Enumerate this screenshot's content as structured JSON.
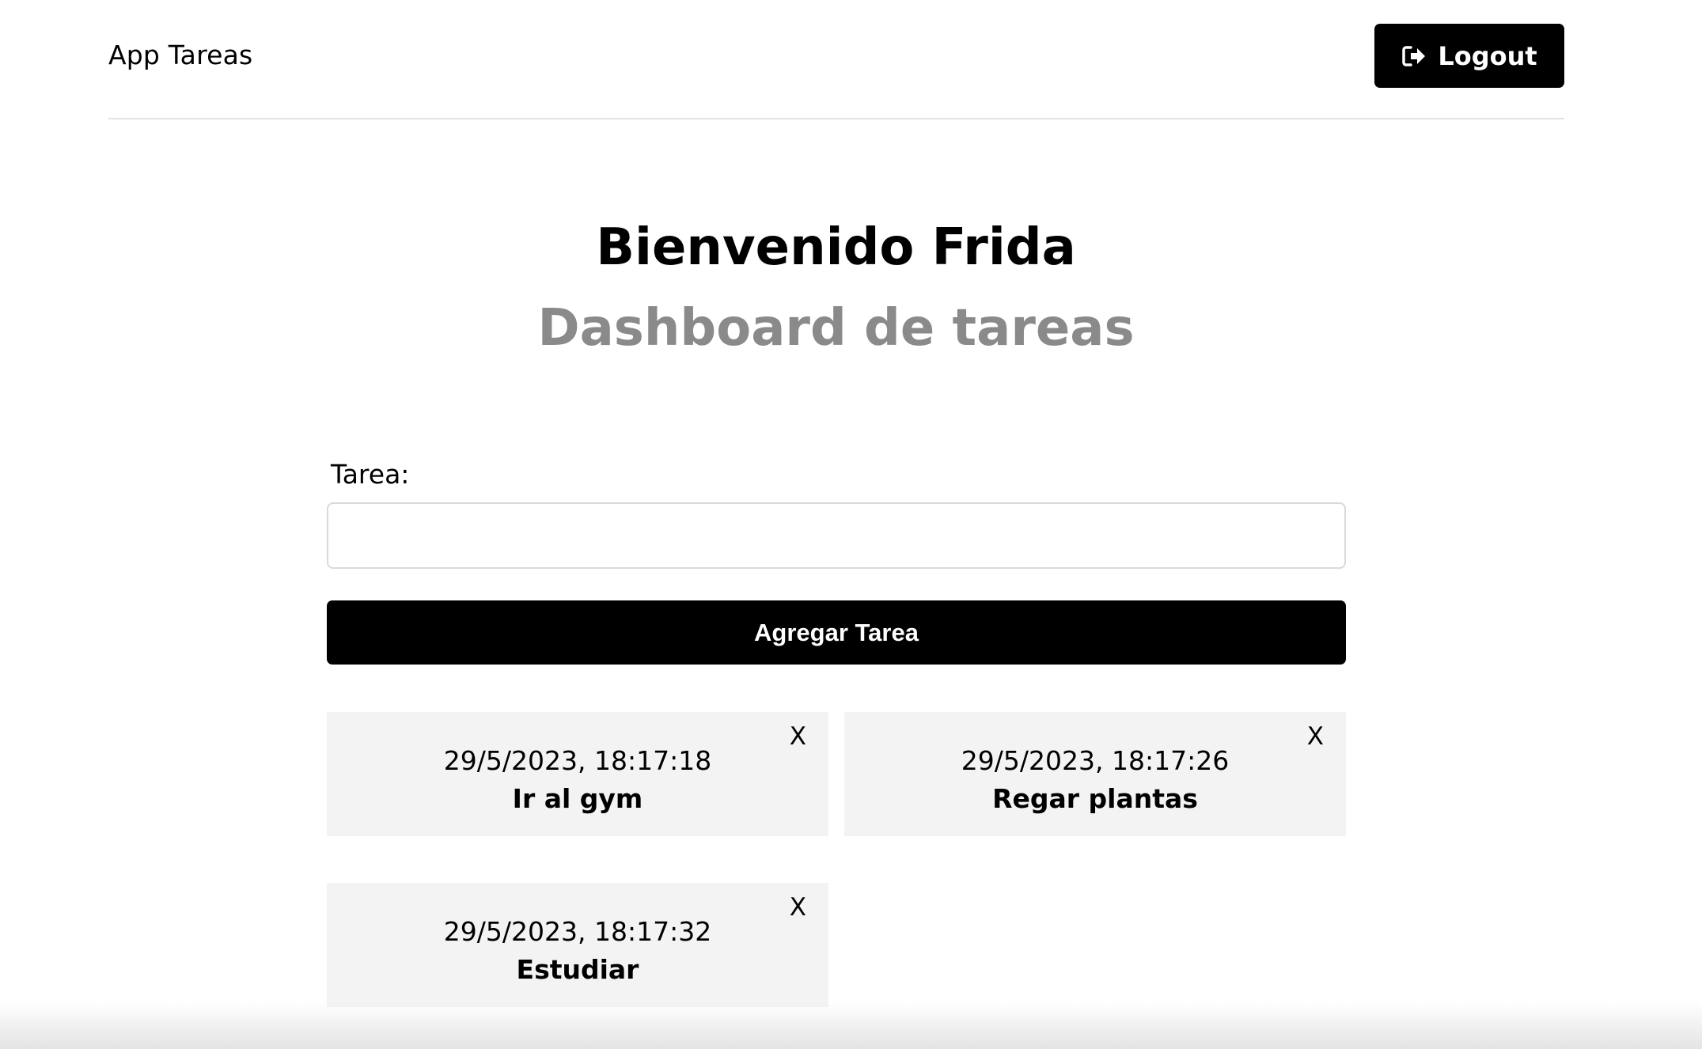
{
  "header": {
    "brand": "App Tareas",
    "logout_label": "Logout",
    "logout_icon": "logout-icon"
  },
  "main": {
    "welcome": "Bienvenido Frida",
    "subtitle": "Dashboard de tareas"
  },
  "form": {
    "label": "Tarea:",
    "input_value": "",
    "submit_label": "Agregar Tarea"
  },
  "tasks": [
    {
      "timestamp": "29/5/2023, 18:17:18",
      "name": "Ir al gym",
      "remove_label": "X"
    },
    {
      "timestamp": "29/5/2023, 18:17:26",
      "name": "Regar plantas",
      "remove_label": "X"
    },
    {
      "timestamp": "29/5/2023, 18:17:32",
      "name": "Estudiar",
      "remove_label": "X"
    }
  ],
  "colors": {
    "primary": "#000000",
    "subtitle": "#8a8a8a",
    "card_bg": "#f3f3f3",
    "divider": "#e3e3e3"
  }
}
